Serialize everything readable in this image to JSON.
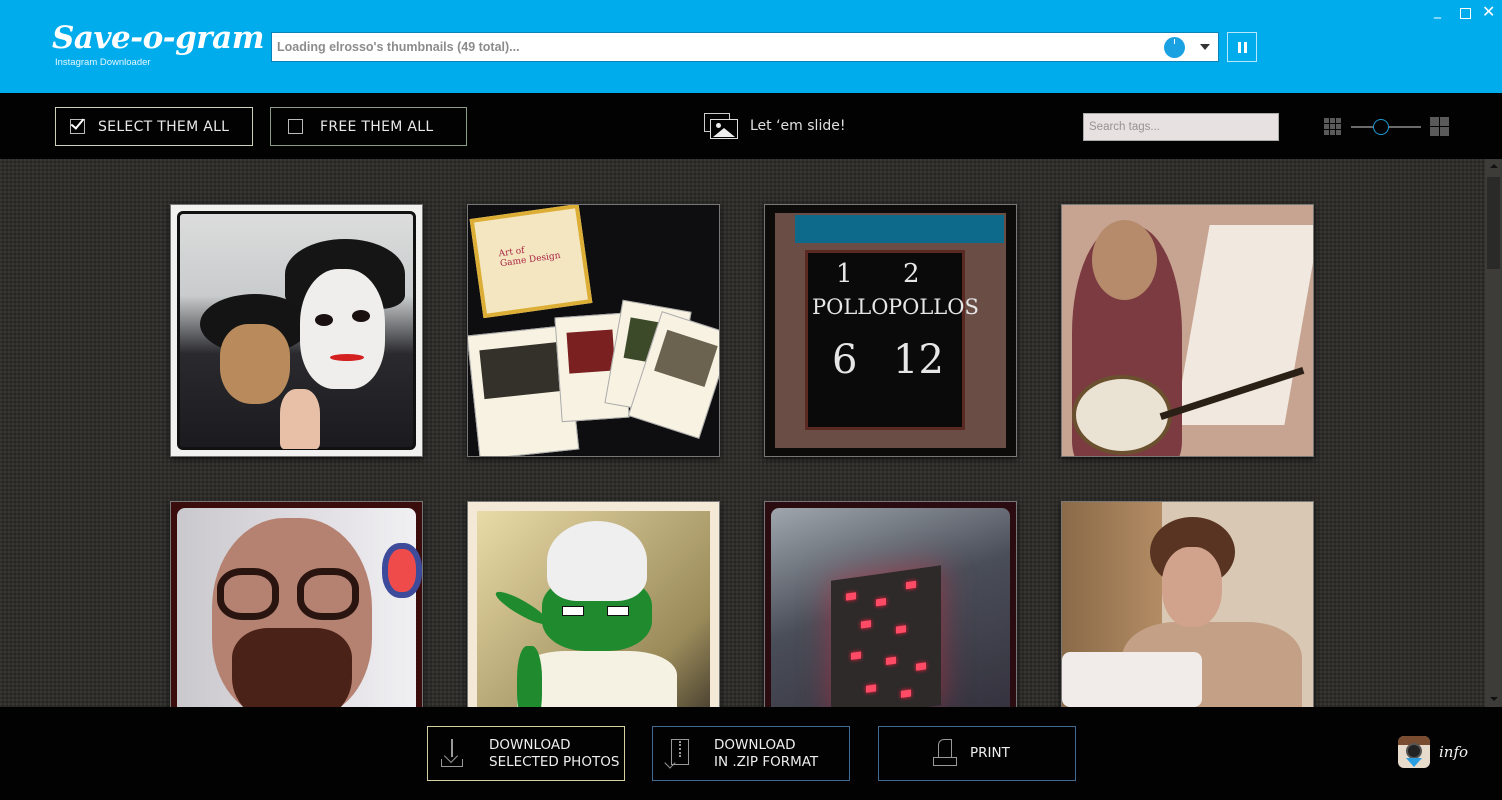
{
  "app": {
    "title": "Save-o-gram",
    "subtitle": "Instagram Downloader",
    "accent_color": "#00acec"
  },
  "window_controls": {
    "minimize": "_",
    "close": "✕"
  },
  "header": {
    "status_text": "Loading elrosso's thumbnails (49 total)...",
    "progress_icon": "progress-pie-icon",
    "dropdown_icon": "dropdown-arrow-icon",
    "pause_icon": "pause-icon"
  },
  "toolbar": {
    "select_all_label": "SELECT THEM ALL",
    "select_all_checked": true,
    "free_all_label": "FREE THEM ALL",
    "free_all_checked": false,
    "slideshow_label": "Let ‘em slide!",
    "search_placeholder": "Search tags...",
    "search_value": "",
    "thumbnail_size_level": 0.4
  },
  "gallery": {
    "total_count": 49,
    "items": [
      {
        "id": 1,
        "description": "Two people wearing Michael Jackson masks",
        "selected": true
      },
      {
        "id": 2,
        "description": "The Art of Game Design card deck",
        "selected": true
      },
      {
        "id": 3,
        "description": "Chalkboard: 1 pollo 6, 2 pollos 12",
        "selected": true,
        "chalk": [
          "1",
          "2",
          "POLLO",
          "POLLOS",
          "6",
          "12"
        ]
      },
      {
        "id": 4,
        "description": "Man playing a banjo in sunlight",
        "selected": true
      },
      {
        "id": 5,
        "description": "Bearded man with glasses",
        "selected": true
      },
      {
        "id": 6,
        "description": "Piccolo plush toy",
        "selected": true
      },
      {
        "id": 7,
        "description": "Glowing redstone ore block lamp",
        "selected": true
      },
      {
        "id": 8,
        "description": "Elderly woman drinking from a cup",
        "selected": true
      }
    ]
  },
  "footer": {
    "download_selected_label": "DOWNLOAD\nSELECTED PHOTOS",
    "download_zip_label": "DOWNLOAD\nIN .ZIP FORMAT",
    "print_label": "PRINT",
    "info_label": "info"
  }
}
